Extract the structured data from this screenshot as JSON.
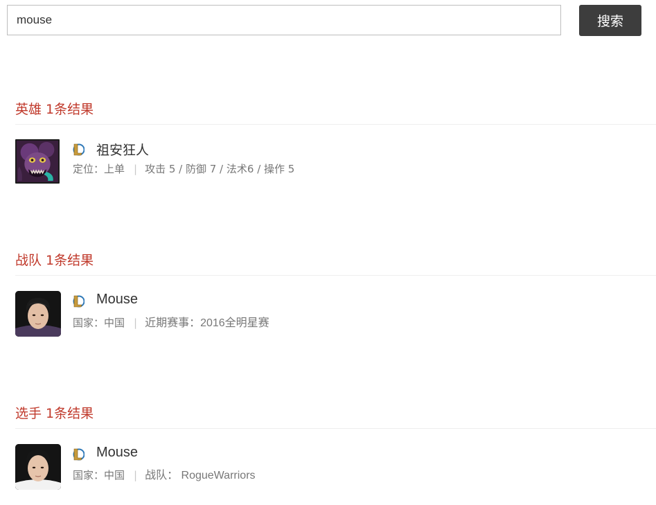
{
  "search": {
    "value": "mouse",
    "placeholder": "",
    "button_label": "搜索"
  },
  "sections": [
    {
      "title": "英雄",
      "count_text": "1条结果",
      "item": {
        "name": "祖安狂人",
        "game_icon": "league-of-legends-icon",
        "avatar": "hero-portrait",
        "meta_left": "定位：上单",
        "meta_right": "攻击 5 / 防御 7 / 法术6 / 操作 5"
      }
    },
    {
      "title": "战队",
      "count_text": "1条结果",
      "item": {
        "name": "Mouse",
        "game_icon": "league-of-legends-icon",
        "avatar": "player-photo",
        "meta_left": "国家：中国",
        "meta_right": "近期赛事：2016全明星赛"
      }
    },
    {
      "title": "选手",
      "count_text": "1条结果",
      "item": {
        "name": "Mouse",
        "game_icon": "league-of-legends-icon",
        "avatar": "player-photo",
        "meta_left": "国家：中国",
        "meta_right": "战队： RogueWarriors"
      }
    }
  ],
  "colors": {
    "accent": "#c0392b",
    "button_bg": "#3d3d3d",
    "meta_text": "#777777",
    "divider": "#eeeeee"
  }
}
